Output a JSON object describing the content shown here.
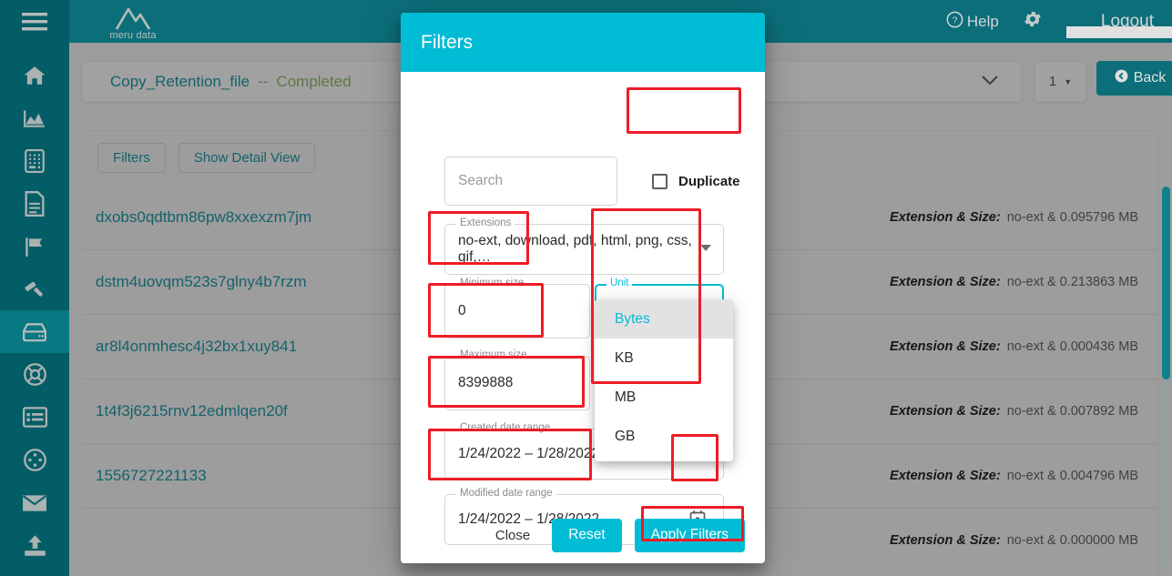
{
  "topbar": {
    "brand": "meru data",
    "help": "Help",
    "gear_icon": "gear-icon",
    "username": "",
    "logout": "Logout"
  },
  "sidebar": {
    "items": [
      {
        "icon": "hamburger-menu-icon",
        "active": false
      },
      {
        "icon": "home-icon",
        "active": false
      },
      {
        "icon": "analytics-chart-icon",
        "active": false
      },
      {
        "icon": "calculator-icon",
        "active": false
      },
      {
        "icon": "document-icon",
        "active": false
      },
      {
        "icon": "flag-icon",
        "active": false
      },
      {
        "icon": "gavel-icon",
        "active": false
      },
      {
        "icon": "database-drive-icon",
        "active": true
      },
      {
        "icon": "lifebuoy-support-icon",
        "active": false
      },
      {
        "icon": "list-view-icon",
        "active": false
      },
      {
        "icon": "film-reel-icon",
        "active": false
      },
      {
        "icon": "envelope-mail-icon",
        "active": false
      },
      {
        "icon": "upload-icon",
        "active": false
      }
    ]
  },
  "page": {
    "title": "Copy_Retention_file",
    "separator": "--",
    "status": "Completed",
    "page_number": "1",
    "back_label": "Back",
    "toolbar": {
      "filters_label": "Filters",
      "detail_view_label": "Show Detail View"
    },
    "meta_label": "Extension & Size:",
    "rows": [
      {
        "name": "dxobs0qdtbm86pw8xxexzm7jm",
        "meta": "no-ext & 0.095796 MB"
      },
      {
        "name": "dstm4uovqm523s7glny4b7rzm",
        "meta": "no-ext & 0.213863 MB"
      },
      {
        "name": "ar8l4onmhesc4j32bx1xuy841",
        "meta": "no-ext & 0.000436 MB"
      },
      {
        "name": "1t4f3j6215rnv12edmlqen20f",
        "meta": "no-ext & 0.007892 MB"
      },
      {
        "name": "1556727221133",
        "meta": "no-ext & 0.004796 MB"
      },
      {
        "name": "",
        "meta": "no-ext & 0.000000 MB"
      }
    ]
  },
  "modal": {
    "title": "Filters",
    "search": {
      "label": "",
      "placeholder": "Search",
      "value": ""
    },
    "duplicate": {
      "label": "Duplicate",
      "checked": false
    },
    "extensions": {
      "label": "Extensions",
      "value": "no-ext, download, pdf, html, png, css, gif,…"
    },
    "minimum_size": {
      "label": "Minimum size",
      "value": "0"
    },
    "maximum_size": {
      "label": "Maximum size",
      "value": "8399888"
    },
    "unit": {
      "label": "Unit",
      "selected": "Bytes",
      "options": [
        "Bytes",
        "KB",
        "MB",
        "GB"
      ]
    },
    "created_date_range": {
      "label": "Created date range",
      "value": "1/24/2022 – 1/28/2022"
    },
    "modified_date_range": {
      "label": "Modified date range",
      "value": "1/24/2022 – 1/28/2022"
    },
    "calendar_icon": "calendar-icon",
    "buttons": {
      "close": "Close",
      "reset": "Reset",
      "apply": "Apply Filters"
    }
  },
  "colors": {
    "rail": "#046a75",
    "rail_active": "#0a8a94",
    "topbar": "#0e7e8a",
    "modal_header": "#00bcd4",
    "accent_link": "#17707a",
    "status_green": "#6b8a4e",
    "highlight_box": "#ee1c25",
    "page_bg": "#b3b3b3"
  }
}
